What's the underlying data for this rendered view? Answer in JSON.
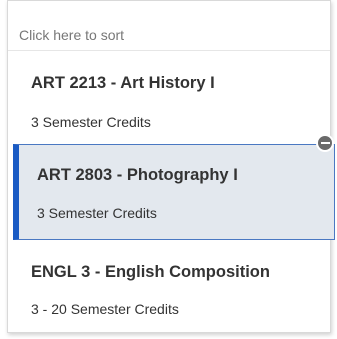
{
  "sort": {
    "label": "Click here to sort"
  },
  "courses": [
    {
      "title": "ART 2213 - Art History I",
      "credits": "3 Semester Credits",
      "selected": false
    },
    {
      "title": "ART 2803 - Photography I",
      "credits": "3 Semester Credits",
      "selected": true
    },
    {
      "title": "ENGL 3 - English Composition",
      "credits": "3 - 20 Semester Credits",
      "selected": false
    }
  ],
  "colors": {
    "selected_background": "#e3e8ee",
    "selected_accent": "#1a5bc4",
    "remove_button": "#6a6a6a"
  },
  "icons": {
    "remove": "minus-circle-icon"
  }
}
